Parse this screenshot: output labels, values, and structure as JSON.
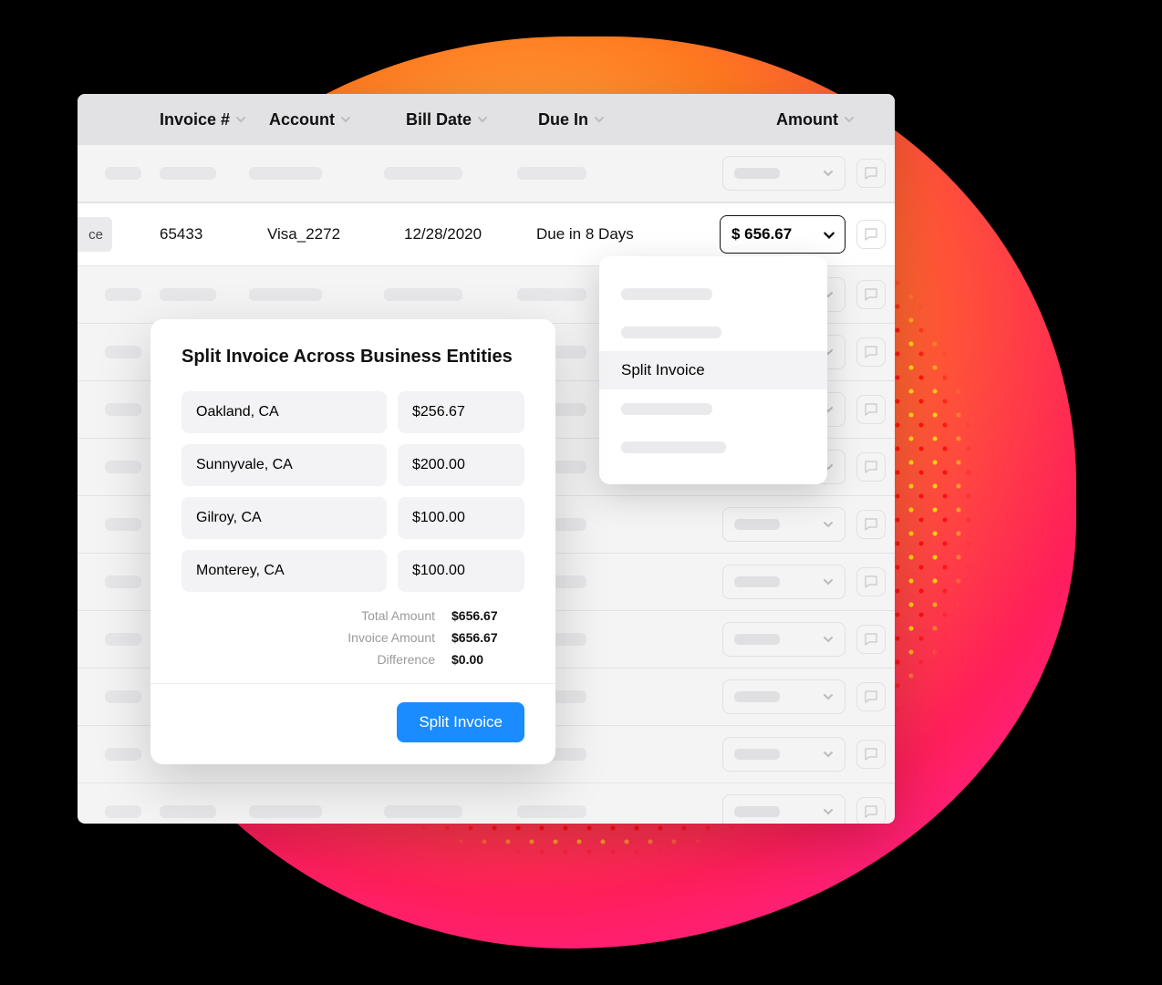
{
  "columns": {
    "invoice": "Invoice #",
    "account": "Account",
    "bill_date": "Bill Date",
    "due_in": "Due In",
    "amount": "Amount"
  },
  "active_row": {
    "tag_suffix": "ce",
    "invoice": "65433",
    "account": "Visa_2272",
    "bill_date": "12/28/2020",
    "due_in": "Due in 8 Days",
    "amount": "$ 656.67"
  },
  "dropdown": {
    "selected_label": "Split Invoice"
  },
  "modal": {
    "title": "Split Invoice Across Business Entities",
    "rows": [
      {
        "location": "Oakland, CA",
        "amount": "$256.67"
      },
      {
        "location": "Sunnyvale, CA",
        "amount": "$200.00"
      },
      {
        "location": "Gilroy, CA",
        "amount": "$100.00"
      },
      {
        "location": "Monterey, CA",
        "amount": "$100.00"
      }
    ],
    "totals": {
      "total_label": "Total Amount",
      "total_value": "$656.67",
      "invoice_label": "Invoice Amount",
      "invoice_value": "$656.67",
      "diff_label": "Difference",
      "diff_value": "$0.00"
    },
    "button": "Split Invoice"
  }
}
